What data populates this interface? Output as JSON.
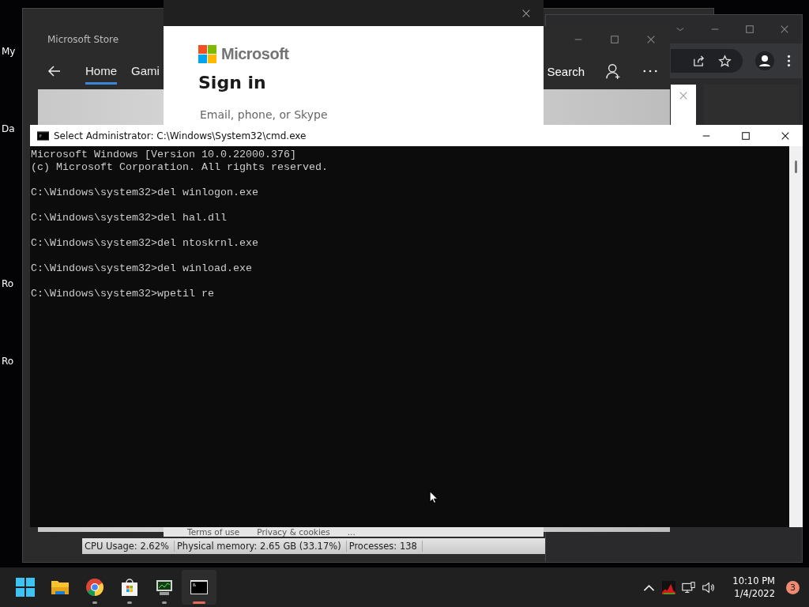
{
  "desktop": {
    "icon_labels": [
      "My",
      "Da",
      "Ro",
      "Ro"
    ]
  },
  "task_manager": {
    "status_bar": [
      "CPU Usage: 2.62%",
      "Physical memory: 2.65 GB (33.17%)",
      "Processes: 138"
    ]
  },
  "store": {
    "title": "Microsoft Store",
    "tabs": [
      {
        "label": "Home",
        "selected": true
      },
      {
        "label": "Gami",
        "selected": false
      }
    ],
    "search": "Search"
  },
  "sign_in": {
    "brand": "Microsoft",
    "title": "Sign in",
    "placeholder": "Email, phone, or Skype",
    "footer": [
      "Terms of use",
      "Privacy & cookies",
      "..."
    ]
  },
  "cmd": {
    "title": "Select Administrator: C:\\Windows\\System32\\cmd.exe",
    "blocks": [
      {
        "lines": [
          "Microsoft Windows [Version 10.0.22000.376]",
          "(c) Microsoft Corporation. All rights reserved."
        ]
      },
      {
        "lines": [
          "C:\\Windows\\system32>del winlogon.exe"
        ]
      },
      {
        "lines": [
          "C:\\Windows\\system32>del hal.dll"
        ]
      },
      {
        "lines": [
          "C:\\Windows\\system32>del ntoskrnl.exe"
        ]
      },
      {
        "lines": [
          "C:\\Windows\\system32>del winload.exe"
        ]
      },
      {
        "lines": [
          "C:\\Windows\\system32>wpetil re"
        ]
      }
    ]
  },
  "taskbar": {
    "apps": [
      {
        "kind": "start",
        "running": false,
        "selected": false
      },
      {
        "kind": "explorer",
        "running": false,
        "selected": false
      },
      {
        "kind": "chrome",
        "running": true,
        "selected": false
      },
      {
        "kind": "store",
        "running": true,
        "selected": false
      },
      {
        "kind": "taskmanager",
        "running": true,
        "selected": false
      },
      {
        "kind": "terminal",
        "running": true,
        "selected": true
      }
    ],
    "time": "10:10 PM",
    "date": "1/4/2022",
    "badge": "3"
  }
}
